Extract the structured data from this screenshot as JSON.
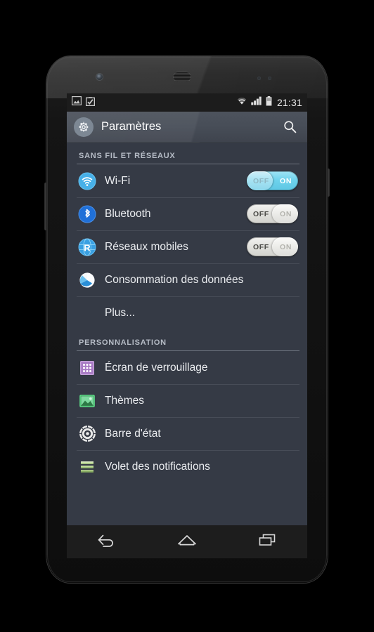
{
  "device": {
    "name": "android-phone-nexus",
    "front_camera": "front-camera",
    "earpiece": "earpiece-speaker"
  },
  "status_bar": {
    "clock": "21:31",
    "left_icons": [
      "image-icon",
      "checkbox-icon"
    ],
    "right_icons": [
      "wifi-signal-icon",
      "cellular-signal-icon",
      "battery-icon"
    ],
    "background": "#1c1c1c"
  },
  "action_bar": {
    "title": "Paramètres",
    "app_icon": "gear-icon",
    "search_icon": "search-icon",
    "background": "#474d57"
  },
  "sections": [
    {
      "header": "SANS FIL ET RÉSEAUX",
      "items": [
        {
          "label": "Wi-Fi",
          "icon": "wifi-icon",
          "icon_color": "#41a8e0",
          "toggle": {
            "state": "on",
            "off_label": "OFF",
            "on_label": "ON"
          }
        },
        {
          "label": "Bluetooth",
          "icon": "bluetooth-icon",
          "icon_color": "#1f6fd0",
          "toggle": {
            "state": "off",
            "off_label": "OFF",
            "on_label": "ON"
          }
        },
        {
          "label": "Réseaux mobiles",
          "icon": "mobile-network-icon",
          "icon_color": "#3a9fe0",
          "toggle": {
            "state": "off",
            "off_label": "OFF",
            "on_label": "ON"
          }
        },
        {
          "label": "Consommation des données",
          "icon": "data-usage-pie-icon",
          "icon_color": "#ffffff",
          "toggle": null
        },
        {
          "label": "Plus...",
          "icon": null,
          "icon_color": null,
          "toggle": null
        }
      ]
    },
    {
      "header": "PERSONNALISATION",
      "items": [
        {
          "label": "Écran de verrouillage",
          "icon": "lock-screen-icon",
          "icon_color": "#a878c0",
          "toggle": null
        },
        {
          "label": "Thèmes",
          "icon": "themes-icon",
          "icon_color": "#4cc878",
          "toggle": null
        },
        {
          "label": "Barre d'état",
          "icon": "status-bar-gear-icon",
          "icon_color": "#e8e8e8",
          "toggle": null
        },
        {
          "label": "Volet des notifications",
          "icon": "notification-panel-icon",
          "icon_color": "#9ec47a",
          "toggle": null
        }
      ]
    }
  ],
  "nav_bar": {
    "buttons": [
      {
        "name": "back-button",
        "icon": "back-arrow-icon"
      },
      {
        "name": "home-button",
        "icon": "home-icon"
      },
      {
        "name": "recents-button",
        "icon": "recents-icon"
      }
    ],
    "background": "#1d1d1d"
  },
  "theme": {
    "list_background": "#353a45",
    "divider": "#474c57",
    "section_rule": "#6d737e",
    "primary_text": "#ebedf0",
    "secondary_text": "#b6bcc6",
    "toggle_on": "#6dd2ec"
  }
}
